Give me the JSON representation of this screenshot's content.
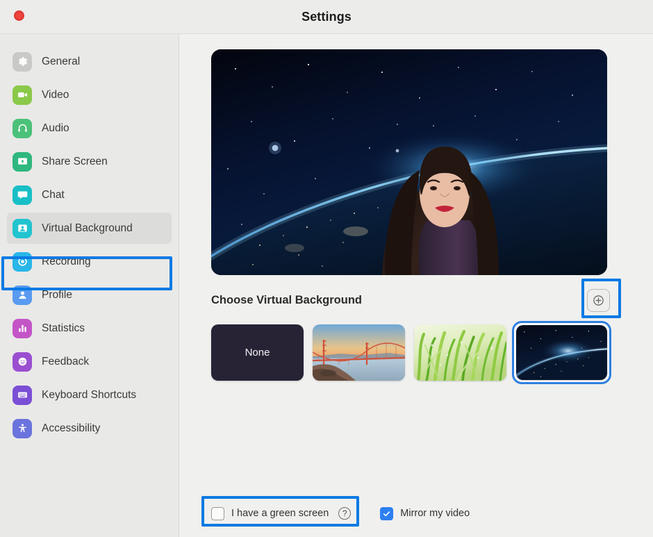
{
  "window": {
    "title": "Settings",
    "close_button": "close-button",
    "accent_blue": "#2d7ff0",
    "annotation_blue": "#0b7ae4"
  },
  "sidebar": {
    "items": [
      {
        "label": "General",
        "icon": "gear-icon",
        "color": "#c9c9c7",
        "active": false
      },
      {
        "label": "Video",
        "icon": "video-icon",
        "color": "#8bc94a",
        "active": false
      },
      {
        "label": "Audio",
        "icon": "headphones-icon",
        "color": "#4cc17a",
        "active": false
      },
      {
        "label": "Share Screen",
        "icon": "share-screen-icon",
        "color": "#2fb77f",
        "active": false
      },
      {
        "label": "Chat",
        "icon": "chat-icon",
        "color": "#18bfc6",
        "active": false
      },
      {
        "label": "Virtual Background",
        "icon": "virtual-background-icon",
        "color": "#21c4cf",
        "active": true
      },
      {
        "label": "Recording",
        "icon": "record-icon",
        "color": "#29b6e8",
        "active": false
      },
      {
        "label": "Profile",
        "icon": "profile-icon",
        "color": "#5a9bf0",
        "active": false
      },
      {
        "label": "Statistics",
        "icon": "statistics-icon",
        "color": "#c455c7",
        "active": false
      },
      {
        "label": "Feedback",
        "icon": "feedback-icon",
        "color": "#9a4fd0",
        "active": false
      },
      {
        "label": "Keyboard Shortcuts",
        "icon": "keyboard-icon",
        "color": "#7a4fd6",
        "active": false
      },
      {
        "label": "Accessibility",
        "icon": "accessibility-icon",
        "color": "#6b73dd",
        "active": false
      }
    ]
  },
  "main": {
    "preview": {
      "name": "video-preview",
      "description": "Webcam preview with Earth from space virtual background"
    },
    "section_title": "Choose Virtual Background",
    "add_button": {
      "label": "+",
      "name": "add-background-button"
    },
    "backgrounds": [
      {
        "label": "None",
        "name": "background-none",
        "selected": false
      },
      {
        "label": "Golden Gate Bridge",
        "name": "background-bridge",
        "selected": false
      },
      {
        "label": "Grass",
        "name": "background-grass",
        "selected": false
      },
      {
        "label": "Earth from Space",
        "name": "background-earth",
        "selected": true
      }
    ]
  },
  "bottom": {
    "green_screen": {
      "label": "I have a green screen",
      "checked": false,
      "help": "?"
    },
    "mirror": {
      "label": "Mirror my video",
      "checked": true,
      "check_glyph": "✓"
    }
  }
}
